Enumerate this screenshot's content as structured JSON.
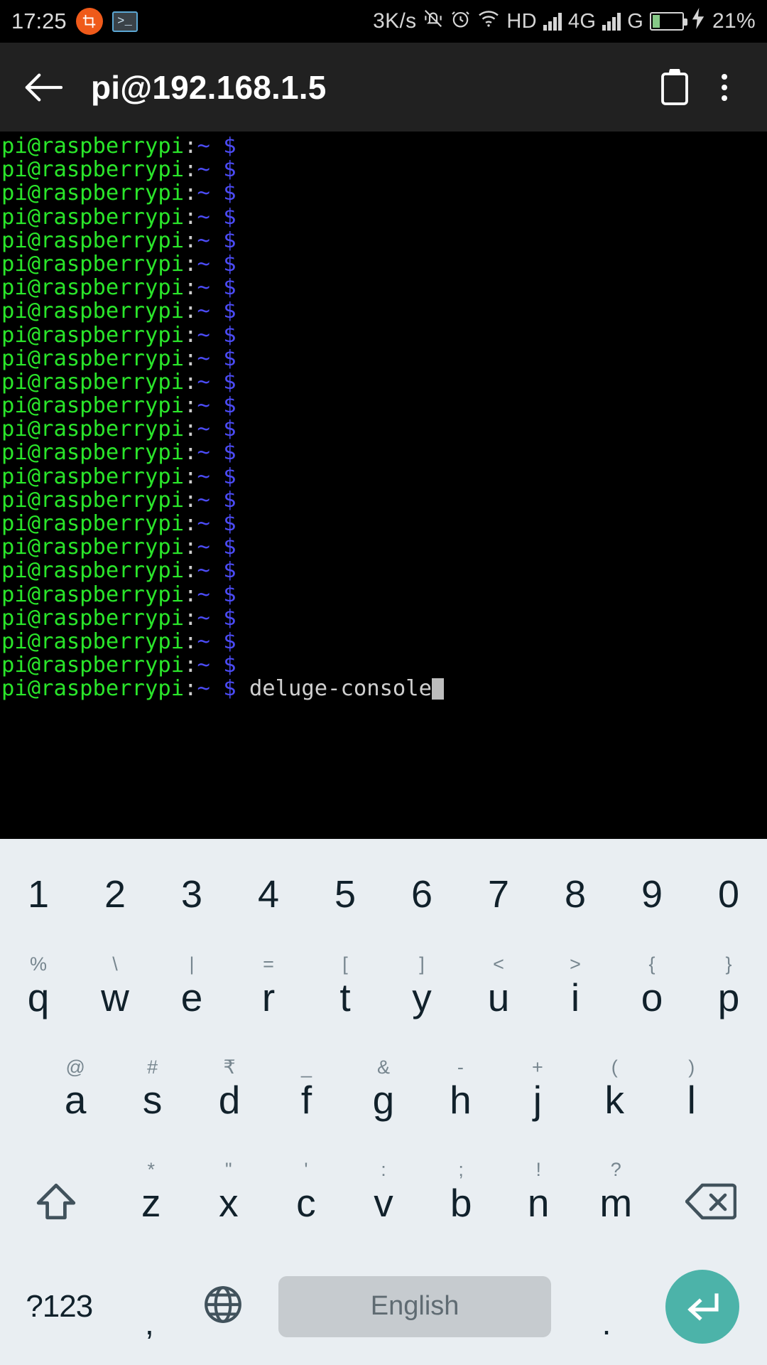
{
  "status_bar": {
    "time": "17:25",
    "network_speed": "3K/s",
    "hd_label": "HD",
    "network_type": "4G",
    "network_gen": "G",
    "battery_percent": "21%",
    "battery_level": 21,
    "icons": [
      "crop-icon",
      "terminal-icon",
      "vibrate-off-icon",
      "alarm-icon",
      "wifi-icon",
      "signal-bars-icon",
      "signal-bars-icon",
      "battery-icon",
      "charging-bolt-icon"
    ],
    "accent_orange": "#ef5a1a",
    "accent_blue": "#5ba7d4",
    "battery_green": "#86c987"
  },
  "app_bar": {
    "title": "pi@192.168.1.5",
    "back_icon": "arrow-left-icon",
    "clipboard_icon": "clipboard-icon",
    "overflow_icon": "more-vertical-icon",
    "background": "#212121"
  },
  "terminal": {
    "background": "#000000",
    "prompt_user": "pi@raspberrypi",
    "prompt_colon": ":",
    "prompt_path": "~",
    "prompt_symbol": "$",
    "colors": {
      "user": "#2ae62a",
      "path": "#4b4bf5",
      "symbol": "#4b4bf5",
      "text": "#cfcfcf",
      "cursor": "#bdbdbd"
    },
    "empty_prompt_count": 23,
    "current_command": "deluge-console",
    "cursor_visible": true
  },
  "keyboard": {
    "background": "#e9eef2",
    "key_text_color": "#11212b",
    "sub_text_color": "#77868f",
    "enter_color": "#4cb3a9",
    "spacebar_color": "#c6cbcf",
    "row_numbers": [
      {
        "main": "1",
        "sub": ""
      },
      {
        "main": "2",
        "sub": ""
      },
      {
        "main": "3",
        "sub": ""
      },
      {
        "main": "4",
        "sub": ""
      },
      {
        "main": "5",
        "sub": ""
      },
      {
        "main": "6",
        "sub": ""
      },
      {
        "main": "7",
        "sub": ""
      },
      {
        "main": "8",
        "sub": ""
      },
      {
        "main": "9",
        "sub": ""
      },
      {
        "main": "0",
        "sub": ""
      }
    ],
    "row_q": [
      {
        "main": "q",
        "sub": "%"
      },
      {
        "main": "w",
        "sub": "\\"
      },
      {
        "main": "e",
        "sub": "|"
      },
      {
        "main": "r",
        "sub": "="
      },
      {
        "main": "t",
        "sub": "["
      },
      {
        "main": "y",
        "sub": "]"
      },
      {
        "main": "u",
        "sub": "<"
      },
      {
        "main": "i",
        "sub": ">"
      },
      {
        "main": "o",
        "sub": "{"
      },
      {
        "main": "p",
        "sub": "}"
      }
    ],
    "row_a": [
      {
        "main": "a",
        "sub": "@"
      },
      {
        "main": "s",
        "sub": "#"
      },
      {
        "main": "d",
        "sub": "₹"
      },
      {
        "main": "f",
        "sub": "_"
      },
      {
        "main": "g",
        "sub": "&"
      },
      {
        "main": "h",
        "sub": "-"
      },
      {
        "main": "j",
        "sub": "+"
      },
      {
        "main": "k",
        "sub": "("
      },
      {
        "main": "l",
        "sub": ")"
      }
    ],
    "row_z": [
      {
        "main": "z",
        "sub": "*"
      },
      {
        "main": "x",
        "sub": "\""
      },
      {
        "main": "c",
        "sub": "'"
      },
      {
        "main": "v",
        "sub": ":"
      },
      {
        "main": "b",
        "sub": ";"
      },
      {
        "main": "n",
        "sub": "!"
      },
      {
        "main": "m",
        "sub": "?"
      }
    ],
    "shift_icon": "shift-up-icon",
    "backspace_icon": "backspace-icon",
    "row_bottom": {
      "symbols_label": "?123",
      "comma_label": ",",
      "globe_icon": "globe-language-icon",
      "space_label": "English",
      "period_label": ".",
      "enter_icon": "enter-return-icon"
    }
  }
}
